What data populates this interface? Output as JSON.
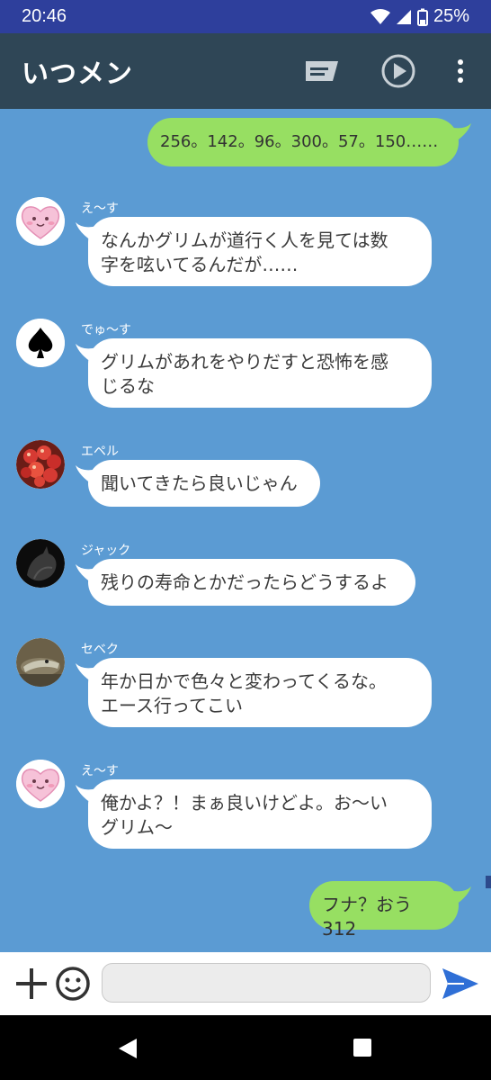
{
  "status": {
    "time": "20:46",
    "battery": "25%"
  },
  "header": {
    "title": "いつメン"
  },
  "messages": [
    {
      "side": "out",
      "text": "256。142。96。300。57。150……"
    },
    {
      "side": "in",
      "sender": "え〜す",
      "avatar": "heart-face",
      "text": "なんかグリムが道行く人を見ては数\n字を呟いてるんだが……"
    },
    {
      "side": "in",
      "sender": "でゅ〜す",
      "avatar": "spade",
      "text": "グリムがあれをやりだすと恐怖を感\nじるな"
    },
    {
      "side": "in",
      "sender": "エペル",
      "avatar": "apples",
      "text": "聞いてきたら良いじゃん"
    },
    {
      "side": "in",
      "sender": "ジャック",
      "avatar": "wolf-silhouette",
      "text": "残りの寿命とかだったらどうするよ"
    },
    {
      "side": "in",
      "sender": "セベク",
      "avatar": "crocodile",
      "text": "年か日かで色々と変わってくるな。\nエース行ってこい"
    },
    {
      "side": "in",
      "sender": "え〜す",
      "avatar": "heart-face",
      "text": "俺かよ？！まぁ良いけどよ。お〜い\nグリム〜"
    },
    {
      "side": "out",
      "text": "フナ？おう312"
    }
  ],
  "input": {
    "value": "",
    "placeholder": ""
  },
  "colors": {
    "chat_bg": "#5b9bd3",
    "header_bg": "#2f4656",
    "status_bg": "#2e3f9c",
    "out_bubble": "#97df62",
    "in_bubble": "#ffffff",
    "send": "#2f6fd6"
  }
}
